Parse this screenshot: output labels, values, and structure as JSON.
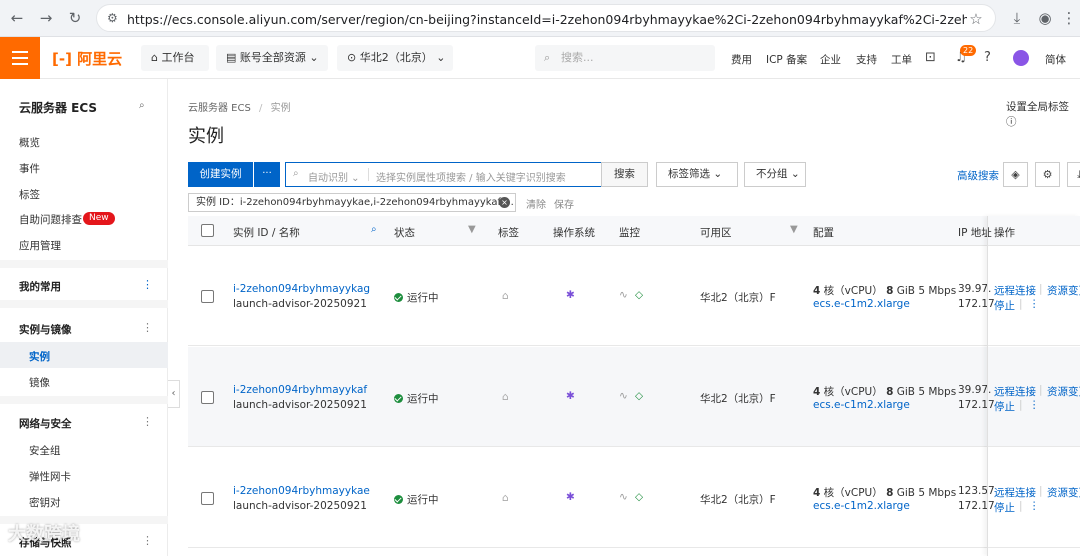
{
  "browser": {
    "url": "https://ecs.console.aliyun.com/server/region/cn-beijing?instanceId=i-2zehon094rbyhmayykae%2Ci-2zehon094rbyhmayykaf%2Ci-2zehon094rbyhmayyka..."
  },
  "header": {
    "logo": "阿里云",
    "workbench": "工作台",
    "all_resources": "账号全部资源",
    "region": "华北2（北京）",
    "search_placeholder": "搜索...",
    "links": [
      "费用",
      "ICP 备案",
      "企业",
      "支持",
      "工单"
    ],
    "notification_count": "22",
    "lang": "简体"
  },
  "sidebar": {
    "title": "云服务器 ECS",
    "items": [
      "概览",
      "事件",
      "标签",
      "自助问题排查",
      "应用管理"
    ],
    "new_badge": "New",
    "favorites": "我的常用",
    "group_instances": "实例与镜像",
    "sub_instances": [
      "实例",
      "镜像"
    ],
    "group_network": "网络与安全",
    "sub_network": [
      "安全组",
      "弹性网卡",
      "密钥对"
    ],
    "group_storage": "存储与快照"
  },
  "main": {
    "breadcrumb_root": "云服务器 ECS",
    "breadcrumb_sep": "/",
    "breadcrumb_current": "实例",
    "title": "实例",
    "global_tag": "设置全局标签",
    "create_button": "创建实例",
    "more_button": "···",
    "auto_detect": "自动识别",
    "search_placeholder": "选择实例属性项搜索 / 输入关键字识别搜索",
    "search_button": "搜索",
    "tag_filter": "标签筛选",
    "no_group": "不分组",
    "advanced_search": "高级搜索",
    "filter_tag": "实例 ID：i-2zehon094rbyhmayykae,i-2zehon094rbyhmayykaf,...",
    "clear": "清除",
    "save": "保存"
  },
  "table": {
    "headers": [
      "实例 ID / 名称",
      "状态",
      "标签",
      "操作系统",
      "监控",
      "可用区",
      "配置",
      "IP 地址",
      "操作"
    ],
    "rows": [
      {
        "id": "i-2zehon094rbyhmayykag",
        "name": "launch-advisor-20250921",
        "status": "运行中",
        "zone": "华北2（北京）F",
        "cpu": "4",
        "cpu_unit": "核（vCPU）",
        "mem": "8",
        "mem_unit": "GiB 5 Mbps",
        "spec": "ecs.e-c1m2.xlarge",
        "ip1": "39.97.",
        "ip2": "172.17",
        "op1": "远程连接",
        "op2": "资源变更",
        "op3": "停止"
      },
      {
        "id": "i-2zehon094rbyhmayykaf",
        "name": "launch-advisor-20250921",
        "status": "运行中",
        "zone": "华北2（北京）F",
        "cpu": "4",
        "cpu_unit": "核（vCPU）",
        "mem": "8",
        "mem_unit": "GiB 5 Mbps",
        "spec": "ecs.e-c1m2.xlarge",
        "ip1": "39.97.",
        "ip2": "172.17",
        "op1": "远程连接",
        "op2": "资源变更",
        "op3": "停止"
      },
      {
        "id": "i-2zehon094rbyhmayykae",
        "name": "launch-advisor-20250921",
        "status": "运行中",
        "zone": "华北2（北京）F",
        "cpu": "4",
        "cpu_unit": "核（vCPU）",
        "mem": "8",
        "mem_unit": "GiB 5 Mbps",
        "spec": "ecs.e-c1m2.xlarge",
        "ip1": "123.57",
        "ip2": "172.17",
        "op1": "远程连接",
        "op2": "资源变更",
        "op3": "停止"
      }
    ]
  },
  "watermark": "大数跨境",
  "colors": {
    "brand": "#ff6a00",
    "primary": "#0064c8",
    "running": "#1e8e3e"
  }
}
